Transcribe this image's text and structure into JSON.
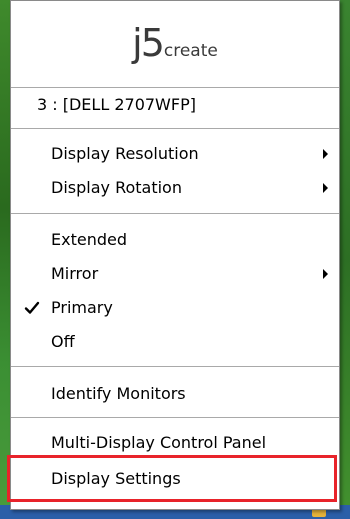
{
  "logo": {
    "brand_main": "j5",
    "brand_sub": "create"
  },
  "menu": {
    "monitor_header": "3 : [DELL 2707WFP]",
    "display_resolution": "Display Resolution",
    "display_rotation": "Display Rotation",
    "extended": "Extended",
    "mirror": "Mirror",
    "primary": "Primary",
    "off": "Off",
    "identify_monitors": "Identify Monitors",
    "multi_display_control_panel": "Multi-Display Control Panel",
    "display_settings": "Display Settings"
  },
  "state": {
    "checked_item": "Primary"
  },
  "colors": {
    "highlight_border": "#e8232a",
    "menu_background": "#ffffff",
    "desktop_green": "#2f6b22",
    "taskbar_blue": "#2b5fa8"
  },
  "icons": {
    "submenu": "chevron-right-icon",
    "checkmark": "checkmark-icon"
  }
}
